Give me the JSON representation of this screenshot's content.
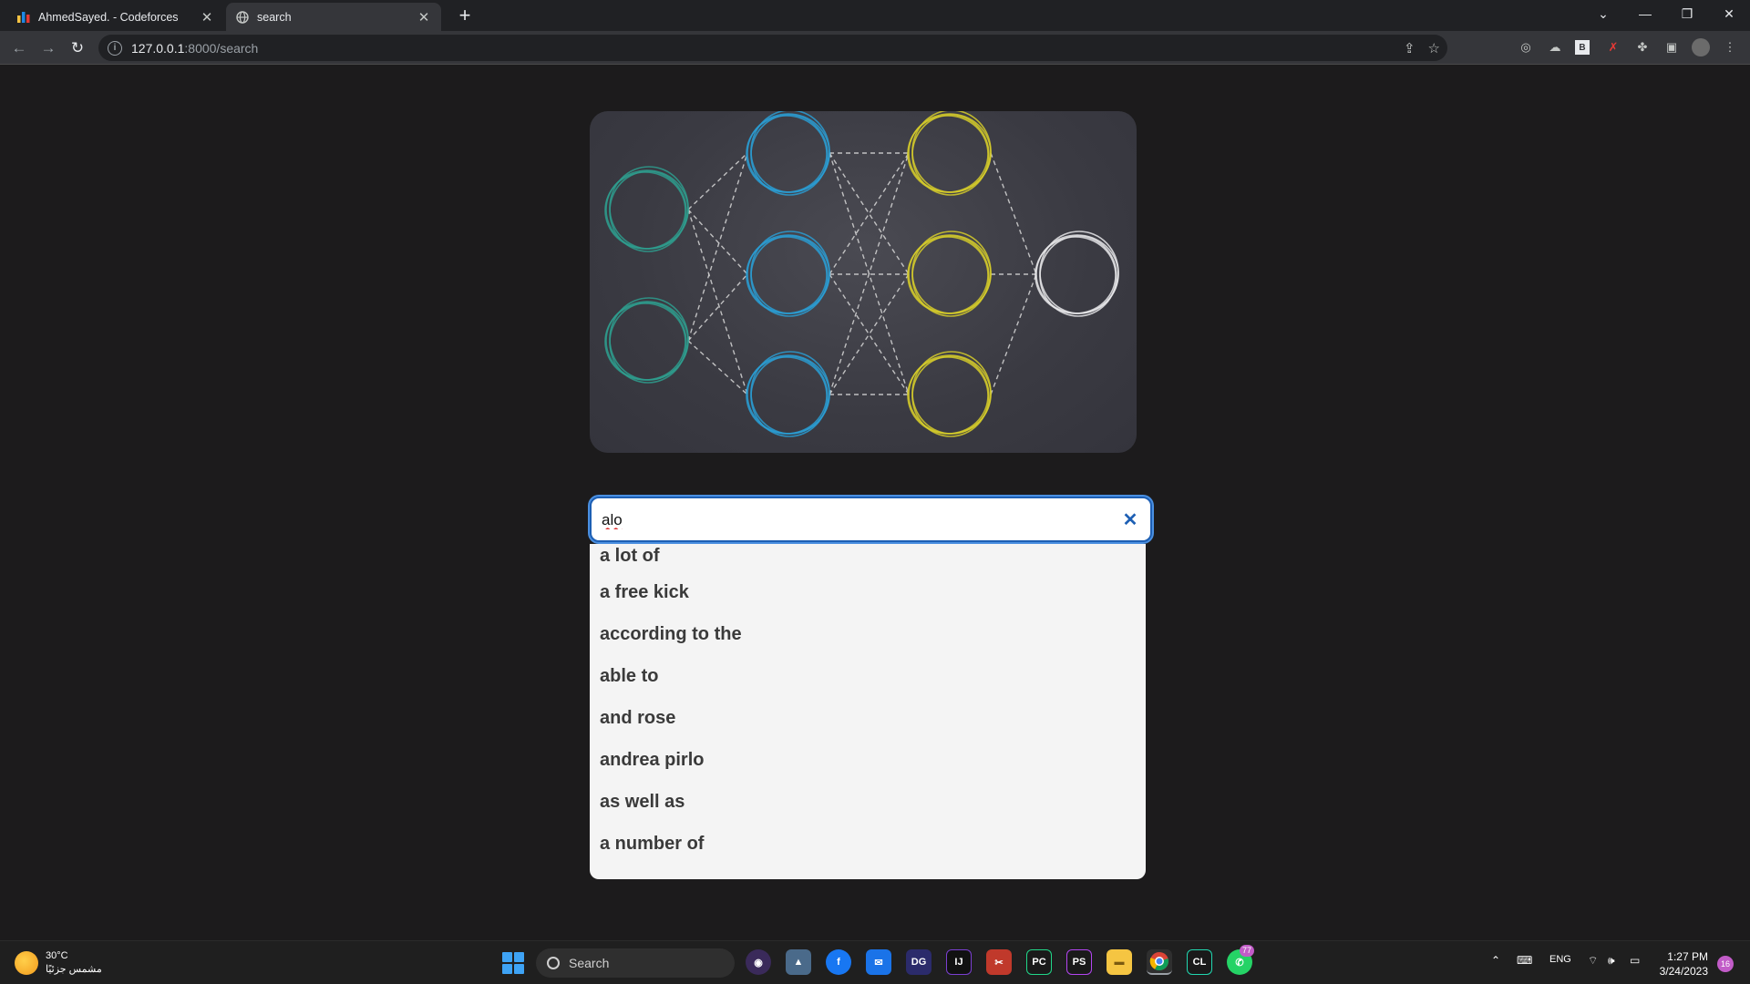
{
  "browser": {
    "tabs": [
      {
        "title": "AhmedSayed. - Codeforces",
        "favicon": "codeforces-icon",
        "active": false
      },
      {
        "title": "search",
        "favicon": "globe-icon",
        "active": true
      }
    ],
    "url_host": "127.0.0.1",
    "url_path": ":8000/search"
  },
  "search": {
    "value": "alo",
    "suggestions": [
      "a lot of",
      "a free kick",
      "according to the",
      "able to",
      "and rose",
      "andrea pirlo",
      "as well as",
      "a number of"
    ]
  },
  "hero": {
    "colors": {
      "input": "#2e9e8e",
      "hidden1": "#2a9ed4",
      "hidden2": "#d6cc2a",
      "output": "#e8e8ea",
      "edges": "#d8d8d8"
    }
  },
  "taskbar": {
    "weather_temp": "30°C",
    "weather_desc": "مشمس جزئيًا",
    "search_label": "Search",
    "language": "ENG",
    "time": "1:27 PM",
    "date": "3/24/2023",
    "notification_count": "16",
    "whatsapp_badge": "77"
  }
}
